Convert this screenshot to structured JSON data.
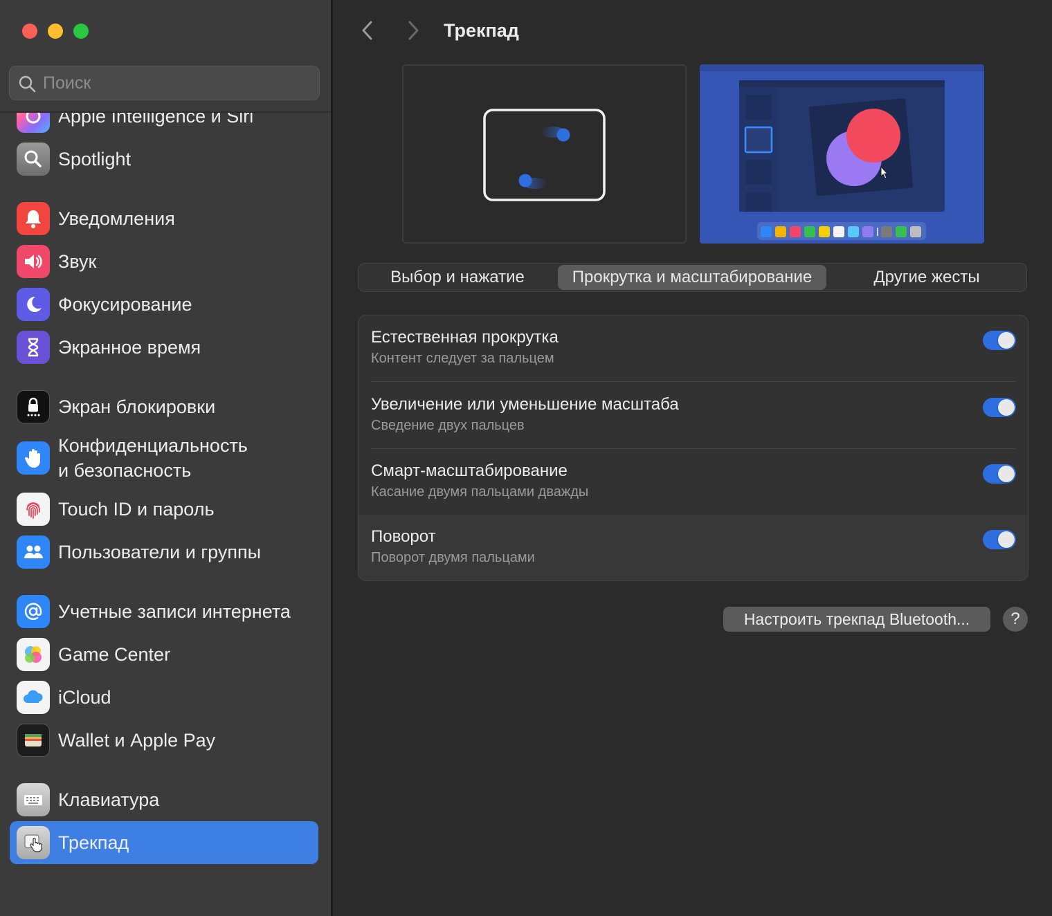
{
  "window": {
    "title": "Трекпад"
  },
  "search": {
    "placeholder": "Поиск",
    "value": ""
  },
  "sidebar": {
    "items": [
      {
        "label": "Apple Intelligence и Siri",
        "icon": "apple-intelligence-siri-icon"
      },
      {
        "label": "Spotlight",
        "icon": "spotlight-icon"
      },
      {
        "label": "Уведомления",
        "icon": "notifications-icon"
      },
      {
        "label": "Звук",
        "icon": "sound-icon"
      },
      {
        "label": "Фокусирование",
        "icon": "focus-icon"
      },
      {
        "label": "Экранное время",
        "icon": "screen-time-icon"
      },
      {
        "label": "Экран блокировки",
        "icon": "lock-screen-icon"
      },
      {
        "label": "Конфиденциальность",
        "label2": "и безопасность",
        "icon": "privacy-security-icon"
      },
      {
        "label": "Touch ID и пароль",
        "icon": "touch-id-icon"
      },
      {
        "label": "Пользователи и группы",
        "icon": "users-groups-icon"
      },
      {
        "label": "Учетные записи интернета",
        "icon": "internet-accounts-icon"
      },
      {
        "label": "Game Center",
        "icon": "game-center-icon"
      },
      {
        "label": "iCloud",
        "icon": "icloud-icon"
      },
      {
        "label": "Wallet и Apple Pay",
        "icon": "wallet-icon"
      },
      {
        "label": "Клавиатура",
        "icon": "keyboard-icon"
      },
      {
        "label": "Трекпад",
        "icon": "trackpad-icon",
        "selected": true
      }
    ]
  },
  "tabs": [
    {
      "label": "Выбор и нажатие",
      "selected": false
    },
    {
      "label": "Прокрутка и масштабирование",
      "selected": true
    },
    {
      "label": "Другие жесты",
      "selected": false
    }
  ],
  "settings": [
    {
      "title": "Естественная прокрутка",
      "subtitle": "Контент следует за пальцем",
      "enabled": true
    },
    {
      "title": "Увеличение или уменьшение масштаба",
      "subtitle": "Сведение двух пальцев",
      "enabled": true
    },
    {
      "title": "Смарт-масштабирование",
      "subtitle": "Касание двумя пальцами дважды",
      "enabled": true
    },
    {
      "title": "Поворот",
      "subtitle": "Поворот двумя пальцами",
      "enabled": true
    }
  ],
  "actions": {
    "bluetooth_label": "Настроить трекпад Bluetooth...",
    "help_label": "?"
  },
  "colors": {
    "accent": "#3d7fe3",
    "toggle_on": "#2f6ee0",
    "sidebar_bg": "#3b3b3b",
    "main_bg": "#2b2b2b"
  }
}
